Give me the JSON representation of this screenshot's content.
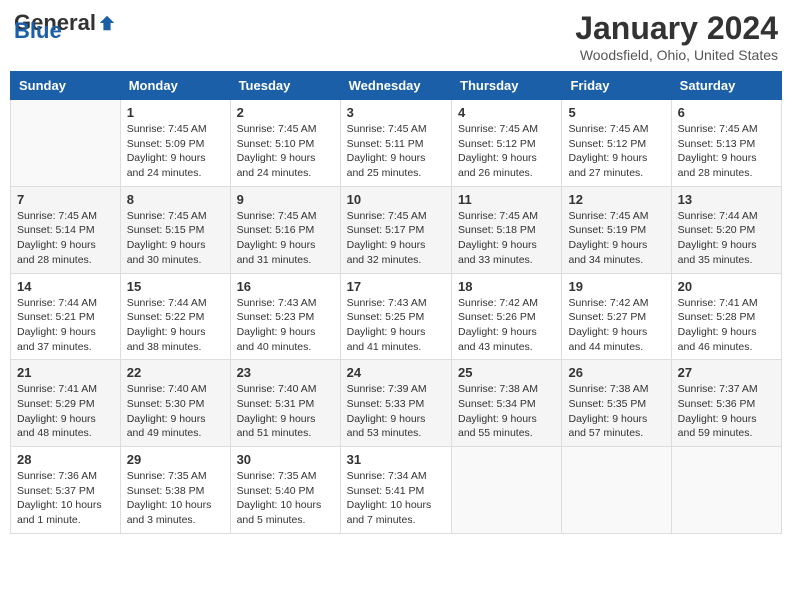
{
  "header": {
    "logo_general": "General",
    "logo_blue": "Blue",
    "month": "January 2024",
    "location": "Woodsfield, Ohio, United States"
  },
  "weekdays": [
    "Sunday",
    "Monday",
    "Tuesday",
    "Wednesday",
    "Thursday",
    "Friday",
    "Saturday"
  ],
  "weeks": [
    [
      {
        "day": "",
        "info": ""
      },
      {
        "day": "1",
        "info": "Sunrise: 7:45 AM\nSunset: 5:09 PM\nDaylight: 9 hours\nand 24 minutes."
      },
      {
        "day": "2",
        "info": "Sunrise: 7:45 AM\nSunset: 5:10 PM\nDaylight: 9 hours\nand 24 minutes."
      },
      {
        "day": "3",
        "info": "Sunrise: 7:45 AM\nSunset: 5:11 PM\nDaylight: 9 hours\nand 25 minutes."
      },
      {
        "day": "4",
        "info": "Sunrise: 7:45 AM\nSunset: 5:12 PM\nDaylight: 9 hours\nand 26 minutes."
      },
      {
        "day": "5",
        "info": "Sunrise: 7:45 AM\nSunset: 5:12 PM\nDaylight: 9 hours\nand 27 minutes."
      },
      {
        "day": "6",
        "info": "Sunrise: 7:45 AM\nSunset: 5:13 PM\nDaylight: 9 hours\nand 28 minutes."
      }
    ],
    [
      {
        "day": "7",
        "info": "Sunrise: 7:45 AM\nSunset: 5:14 PM\nDaylight: 9 hours\nand 28 minutes."
      },
      {
        "day": "8",
        "info": "Sunrise: 7:45 AM\nSunset: 5:15 PM\nDaylight: 9 hours\nand 30 minutes."
      },
      {
        "day": "9",
        "info": "Sunrise: 7:45 AM\nSunset: 5:16 PM\nDaylight: 9 hours\nand 31 minutes."
      },
      {
        "day": "10",
        "info": "Sunrise: 7:45 AM\nSunset: 5:17 PM\nDaylight: 9 hours\nand 32 minutes."
      },
      {
        "day": "11",
        "info": "Sunrise: 7:45 AM\nSunset: 5:18 PM\nDaylight: 9 hours\nand 33 minutes."
      },
      {
        "day": "12",
        "info": "Sunrise: 7:45 AM\nSunset: 5:19 PM\nDaylight: 9 hours\nand 34 minutes."
      },
      {
        "day": "13",
        "info": "Sunrise: 7:44 AM\nSunset: 5:20 PM\nDaylight: 9 hours\nand 35 minutes."
      }
    ],
    [
      {
        "day": "14",
        "info": "Sunrise: 7:44 AM\nSunset: 5:21 PM\nDaylight: 9 hours\nand 37 minutes."
      },
      {
        "day": "15",
        "info": "Sunrise: 7:44 AM\nSunset: 5:22 PM\nDaylight: 9 hours\nand 38 minutes."
      },
      {
        "day": "16",
        "info": "Sunrise: 7:43 AM\nSunset: 5:23 PM\nDaylight: 9 hours\nand 40 minutes."
      },
      {
        "day": "17",
        "info": "Sunrise: 7:43 AM\nSunset: 5:25 PM\nDaylight: 9 hours\nand 41 minutes."
      },
      {
        "day": "18",
        "info": "Sunrise: 7:42 AM\nSunset: 5:26 PM\nDaylight: 9 hours\nand 43 minutes."
      },
      {
        "day": "19",
        "info": "Sunrise: 7:42 AM\nSunset: 5:27 PM\nDaylight: 9 hours\nand 44 minutes."
      },
      {
        "day": "20",
        "info": "Sunrise: 7:41 AM\nSunset: 5:28 PM\nDaylight: 9 hours\nand 46 minutes."
      }
    ],
    [
      {
        "day": "21",
        "info": "Sunrise: 7:41 AM\nSunset: 5:29 PM\nDaylight: 9 hours\nand 48 minutes."
      },
      {
        "day": "22",
        "info": "Sunrise: 7:40 AM\nSunset: 5:30 PM\nDaylight: 9 hours\nand 49 minutes."
      },
      {
        "day": "23",
        "info": "Sunrise: 7:40 AM\nSunset: 5:31 PM\nDaylight: 9 hours\nand 51 minutes."
      },
      {
        "day": "24",
        "info": "Sunrise: 7:39 AM\nSunset: 5:33 PM\nDaylight: 9 hours\nand 53 minutes."
      },
      {
        "day": "25",
        "info": "Sunrise: 7:38 AM\nSunset: 5:34 PM\nDaylight: 9 hours\nand 55 minutes."
      },
      {
        "day": "26",
        "info": "Sunrise: 7:38 AM\nSunset: 5:35 PM\nDaylight: 9 hours\nand 57 minutes."
      },
      {
        "day": "27",
        "info": "Sunrise: 7:37 AM\nSunset: 5:36 PM\nDaylight: 9 hours\nand 59 minutes."
      }
    ],
    [
      {
        "day": "28",
        "info": "Sunrise: 7:36 AM\nSunset: 5:37 PM\nDaylight: 10 hours\nand 1 minute."
      },
      {
        "day": "29",
        "info": "Sunrise: 7:35 AM\nSunset: 5:38 PM\nDaylight: 10 hours\nand 3 minutes."
      },
      {
        "day": "30",
        "info": "Sunrise: 7:35 AM\nSunset: 5:40 PM\nDaylight: 10 hours\nand 5 minutes."
      },
      {
        "day": "31",
        "info": "Sunrise: 7:34 AM\nSunset: 5:41 PM\nDaylight: 10 hours\nand 7 minutes."
      },
      {
        "day": "",
        "info": ""
      },
      {
        "day": "",
        "info": ""
      },
      {
        "day": "",
        "info": ""
      }
    ]
  ]
}
